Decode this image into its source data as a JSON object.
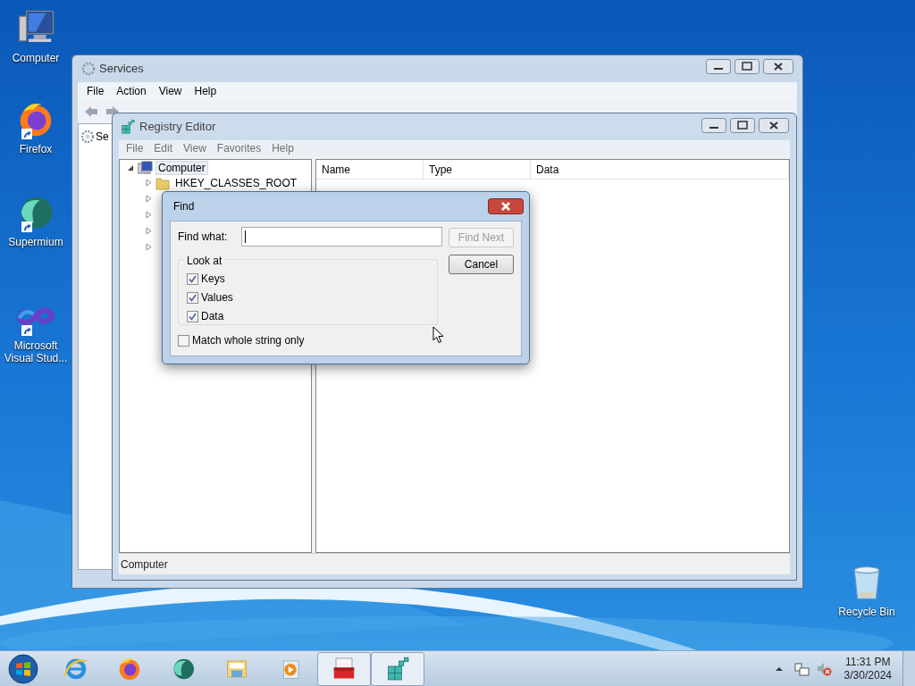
{
  "desktop_icons": [
    {
      "kind": "computer",
      "label": "Computer",
      "shortcut": false
    },
    {
      "kind": "firefox",
      "label": "Firefox",
      "shortcut": true
    },
    {
      "kind": "supermium",
      "label": "Supermium",
      "shortcut": true
    },
    {
      "kind": "visual-studio",
      "label": "Microsoft Visual Stud...",
      "shortcut": true
    },
    {
      "kind": "recycle-bin",
      "label": "Recycle Bin",
      "shortcut": false
    }
  ],
  "services_window": {
    "title": "Services",
    "menu": [
      "File",
      "Action",
      "View",
      "Help"
    ],
    "tree_item": "Se"
  },
  "registry_window": {
    "title": "Registry Editor",
    "menu": [
      "File",
      "Edit",
      "View",
      "Favorites",
      "Help"
    ],
    "tree": [
      {
        "label": "Computer",
        "expanded": true,
        "selected": true,
        "children": [
          {
            "label": "HKEY_CLASSES_ROOT",
            "expanded": false
          }
        ]
      }
    ],
    "columns": [
      "Name",
      "Type",
      "Data"
    ],
    "status_bar": "Computer"
  },
  "find_dialog": {
    "title": "Find",
    "find_what_label": "Find what:",
    "buttons": [
      {
        "label": "Find Next",
        "disabled": true
      },
      {
        "label": "Cancel",
        "disabled": false
      }
    ],
    "look_at": {
      "label": "Look at",
      "options": [
        {
          "label": "Keys",
          "checked": true
        },
        {
          "label": "Values",
          "checked": true
        },
        {
          "label": "Data",
          "checked": true
        }
      ]
    },
    "match_whole": {
      "label": "Match whole string only",
      "checked": false
    }
  },
  "taskbar": {
    "apps": [
      {
        "kind": "ie",
        "active": false
      },
      {
        "kind": "firefox",
        "active": false
      },
      {
        "kind": "supermium",
        "active": false
      },
      {
        "kind": "explorer",
        "active": false
      },
      {
        "kind": "media",
        "active": false
      },
      {
        "kind": "toolbox",
        "active": true
      },
      {
        "kind": "registry",
        "active": true
      }
    ],
    "time": "11:31 PM",
    "date": "3/30/2024"
  }
}
